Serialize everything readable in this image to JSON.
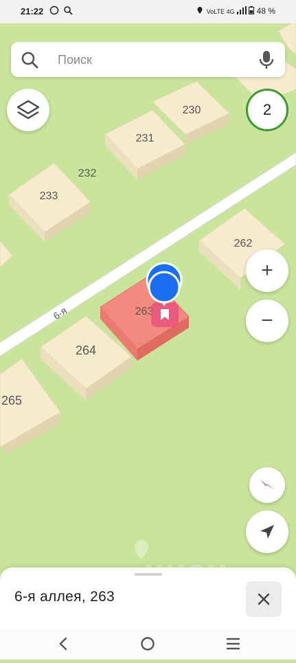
{
  "status_bar": {
    "time": "21:22",
    "network": "VoLTE 4G",
    "battery": "48 %"
  },
  "search": {
    "placeholder": "Поиск"
  },
  "map": {
    "parcels": [
      {
        "label": "230"
      },
      {
        "label": "231"
      },
      {
        "label": "232"
      },
      {
        "label": "233"
      },
      {
        "label": "262"
      },
      {
        "label": "263"
      },
      {
        "label": "264"
      },
      {
        "label": "265"
      }
    ],
    "road_label": "6-я",
    "selected_color": "#f28a80",
    "parcel_color": "#f6ebcd",
    "marker_color": "#1a6ff0",
    "watermark": "циан"
  },
  "controls": {
    "cluster_count": "2",
    "zoom_in": "+",
    "zoom_out": "−"
  },
  "bottom_sheet": {
    "address": "6-я аллея, 263"
  }
}
